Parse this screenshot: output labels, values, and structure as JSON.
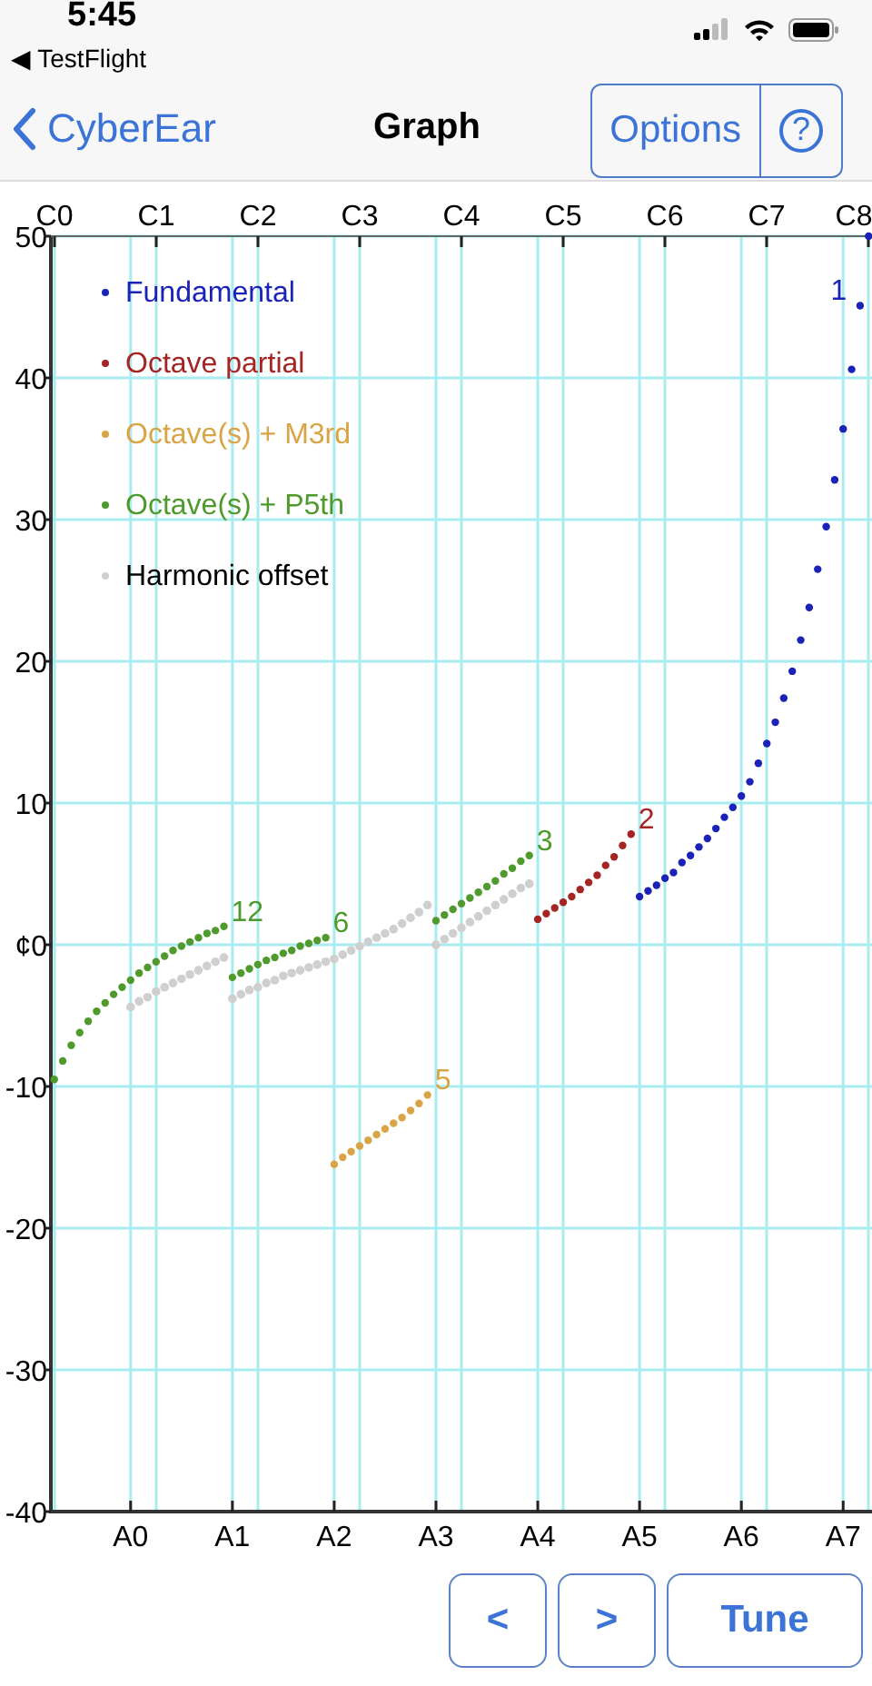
{
  "status_bar": {
    "time": "5:45",
    "back_app": "◀ TestFlight"
  },
  "nav_bar": {
    "back": "CyberEar",
    "title": "Graph",
    "buttons": [
      "Options",
      "?"
    ]
  },
  "graph": {
    "chart_data": {
      "type": "scatter",
      "categories": [
        null,
        null,
        null,
        null,
        null,
        null,
        null,
        null,
        null,
        "A0",
        null,
        null,
        null,
        null,
        null,
        null,
        null,
        null,
        null,
        null,
        null,
        "A1",
        null,
        null,
        null,
        null,
        null,
        null,
        null,
        null,
        null,
        null,
        null,
        "A2",
        null,
        null,
        null,
        null,
        null,
        null,
        null,
        null,
        null,
        null,
        null,
        "A3",
        null,
        null,
        null,
        null,
        null,
        null,
        null,
        null,
        null,
        null,
        null,
        "A4",
        null,
        null,
        null,
        null,
        null,
        null,
        null,
        null,
        null,
        null,
        null,
        "A5",
        null,
        null,
        null,
        null,
        null,
        null,
        null,
        null,
        null,
        null,
        null,
        "A6",
        null,
        null,
        null,
        null,
        null,
        null,
        null,
        null,
        null,
        null,
        null,
        "A7",
        null,
        null,
        null
      ],
      "series": [
        {
          "name": "Fundamental",
          "color": "#1a22b8",
          "values": [
            null,
            null,
            null,
            null,
            null,
            null,
            null,
            null,
            null,
            null,
            null,
            null,
            null,
            null,
            null,
            null,
            null,
            null,
            null,
            null,
            null,
            null,
            null,
            null,
            null,
            null,
            null,
            null,
            null,
            null,
            null,
            null,
            null,
            null,
            null,
            null,
            null,
            null,
            null,
            null,
            null,
            null,
            null,
            null,
            null,
            null,
            null,
            null,
            null,
            null,
            null,
            null,
            null,
            null,
            null,
            null,
            null,
            null,
            null,
            null,
            null,
            null,
            null,
            null,
            null,
            null,
            null,
            null,
            null,
            3.4,
            3.8,
            4.2,
            4.7,
            5.1,
            5.8,
            6.3,
            6.9,
            7.5,
            8.2,
            9.0,
            9.7,
            10.5,
            11.5,
            12.8,
            14.2,
            15.7,
            17.4,
            19.3,
            21.5,
            23.8,
            26.5,
            29.5,
            32.8,
            36.4,
            40.6,
            45.1,
            50.0
          ]
        },
        {
          "name": "Octave partial",
          "color": "#a52424",
          "values": [
            null,
            null,
            null,
            null,
            null,
            null,
            null,
            null,
            null,
            null,
            null,
            null,
            null,
            null,
            null,
            null,
            null,
            null,
            null,
            null,
            null,
            null,
            null,
            null,
            null,
            null,
            null,
            null,
            null,
            null,
            null,
            null,
            null,
            null,
            null,
            null,
            null,
            null,
            null,
            null,
            null,
            null,
            null,
            null,
            null,
            null,
            null,
            null,
            null,
            null,
            null,
            null,
            null,
            null,
            null,
            null,
            null,
            1.8,
            2.2,
            2.6,
            3.0,
            3.4,
            3.9,
            4.4,
            4.9,
            5.6,
            6.2,
            7.0,
            7.8,
            null,
            null,
            null,
            null,
            null,
            null,
            null,
            null,
            null,
            null,
            null,
            null,
            null,
            null,
            null,
            null,
            null,
            null,
            null,
            null,
            null,
            null,
            null,
            null,
            null,
            null,
            null,
            null
          ]
        },
        {
          "name": "Octave(s) + M3rd",
          "color": "#d9a445",
          "values": [
            null,
            null,
            null,
            null,
            null,
            null,
            null,
            null,
            null,
            null,
            null,
            null,
            null,
            null,
            null,
            null,
            null,
            null,
            null,
            null,
            null,
            null,
            null,
            null,
            null,
            null,
            null,
            null,
            null,
            null,
            null,
            null,
            null,
            -15.5,
            -15.0,
            -14.6,
            -14.2,
            -13.8,
            -13.4,
            -13.0,
            -12.6,
            -12.2,
            -11.7,
            -11.2,
            -10.6,
            null,
            null,
            null,
            null,
            null,
            null,
            null,
            null,
            null,
            null,
            null,
            null,
            null,
            null,
            null,
            null,
            null,
            null,
            null,
            null,
            null,
            null,
            null,
            null,
            null,
            null,
            null,
            null,
            null,
            null,
            null,
            null,
            null,
            null,
            null,
            null,
            null,
            null,
            null,
            null,
            null,
            null,
            null,
            null,
            null,
            null,
            null,
            null,
            null,
            null,
            null,
            null
          ]
        },
        {
          "name": "Octave(s) + P5th",
          "color": "#4e9a2c",
          "values": [
            -9.5,
            -8.2,
            -7.1,
            -6.2,
            -5.4,
            -4.7,
            -4.1,
            -3.5,
            -3.0,
            -2.5,
            -2.0,
            -1.6,
            -1.2,
            -0.8,
            -0.4,
            -0.1,
            0.2,
            0.5,
            0.8,
            1.0,
            1.3,
            -2.3,
            -2.0,
            -1.7,
            -1.4,
            -1.1,
            -0.9,
            -0.6,
            -0.4,
            -0.1,
            0.1,
            0.3,
            0.5,
            null,
            null,
            null,
            null,
            null,
            null,
            null,
            null,
            null,
            null,
            null,
            null,
            1.7,
            2.1,
            2.5,
            2.9,
            3.3,
            3.7,
            4.1,
            4.5,
            5.0,
            5.4,
            5.9,
            6.3,
            null,
            null,
            null,
            null,
            null,
            null,
            null,
            null,
            null,
            null,
            null,
            null,
            null,
            null,
            null,
            null,
            null,
            null,
            null,
            null,
            null,
            null,
            null,
            null,
            null,
            null,
            null,
            null,
            null,
            null,
            null,
            null,
            null,
            null,
            null,
            null,
            null,
            null,
            null,
            null
          ]
        },
        {
          "name": "Harmonic offset",
          "color": "#cfcfcf",
          "values": [
            null,
            null,
            null,
            null,
            null,
            null,
            null,
            null,
            null,
            -4.4,
            -4.0,
            -3.7,
            -3.3,
            -3.0,
            -2.7,
            -2.4,
            -2.1,
            -1.8,
            -1.5,
            -1.2,
            -0.9,
            -3.8,
            -3.5,
            -3.2,
            -3.0,
            -2.7,
            -2.5,
            -2.2,
            -2.0,
            -1.8,
            -1.6,
            -1.4,
            -1.2,
            -1.0,
            -0.7,
            -0.4,
            -0.1,
            0.2,
            0.5,
            0.8,
            1.1,
            1.5,
            1.9,
            2.3,
            2.8,
            0.0,
            0.4,
            0.8,
            1.2,
            1.6,
            2.0,
            2.4,
            2.8,
            3.2,
            3.6,
            4.0,
            4.3,
            null,
            null,
            null,
            null,
            null,
            null,
            null,
            null,
            null,
            null,
            null,
            null,
            null,
            null,
            null,
            null,
            null,
            null,
            null,
            null,
            null,
            null,
            null,
            null,
            null,
            null,
            null,
            null,
            null,
            null,
            null,
            null,
            null,
            null,
            null,
            null,
            null,
            null,
            null,
            null
          ]
        }
      ],
      "ylim": [
        -40,
        50
      ],
      "yticks": [
        {
          "value": 50,
          "label": "50"
        },
        {
          "value": 40,
          "label": "40"
        },
        {
          "value": 30,
          "label": "30"
        },
        {
          "value": 20,
          "label": "20"
        },
        {
          "value": 10,
          "label": "10"
        },
        {
          "value": 0,
          "label": "¢0"
        },
        {
          "value": -10,
          "label": "-10"
        },
        {
          "value": -20,
          "label": "-20"
        },
        {
          "value": -30,
          "label": "-30"
        },
        {
          "value": -40,
          "label": "-40"
        }
      ],
      "grid": true,
      "legend": "upper left",
      "annotations": [
        "1",
        "2",
        "3",
        "12",
        "6",
        "5"
      ]
    },
    "top_axis_labels": [
      "C0",
      "C1",
      "C2",
      "C3",
      "C4",
      "C5",
      "C6",
      "C7",
      "C8"
    ]
  },
  "buttons": [
    "<",
    ">",
    "Tune"
  ]
}
